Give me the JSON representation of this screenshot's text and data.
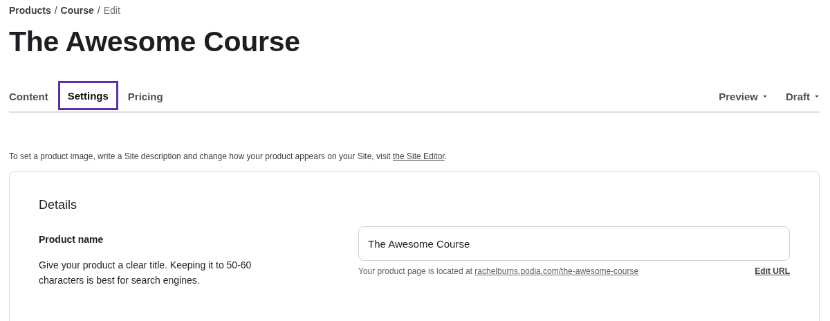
{
  "breadcrumb": {
    "separator": "/",
    "items": [
      {
        "label": "Products",
        "current": false
      },
      {
        "label": "Course",
        "current": false
      },
      {
        "label": "Edit",
        "current": true
      }
    ]
  },
  "title": "The Awesome Course",
  "tabs": [
    {
      "label": "Content",
      "selected": false,
      "focused": false
    },
    {
      "label": "Settings",
      "selected": true,
      "focused": true
    },
    {
      "label": "Pricing",
      "selected": false,
      "focused": false
    }
  ],
  "menus": [
    {
      "label": "Preview"
    },
    {
      "label": "Draft"
    }
  ],
  "note": {
    "text": "To set a product image, write a Site description and change how your product appears on your Site, visit ",
    "link": "the Site Editor",
    "end": "."
  },
  "details": {
    "heading": "Details",
    "field_label": "Product name",
    "help": "Give your product a clear title. Keeping it to 50-60 characters is best for search engines.",
    "value": "The Awesome Course",
    "location_text": "Your product page is located at ",
    "location_link": "rachelburns.podia.com/the-awesome-course",
    "edit_link": "Edit URL"
  }
}
